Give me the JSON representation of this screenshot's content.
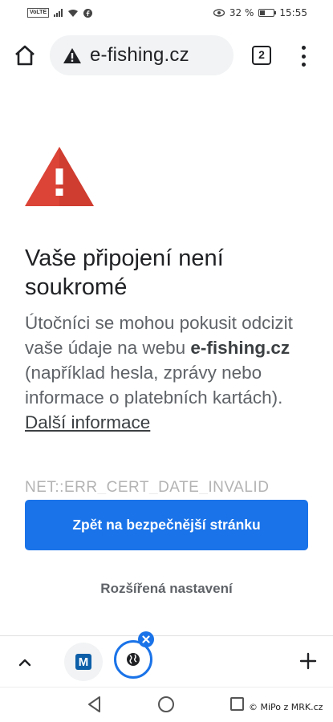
{
  "status_bar": {
    "volte": "VoLTE",
    "battery_percent": "32 %",
    "battery_level": 0.32,
    "time": "15:55"
  },
  "address_bar": {
    "url": "e-fishing.cz",
    "tab_count": "2"
  },
  "page": {
    "heading": "Vaše připojení není soukromé",
    "para_1": "Útočníci se mohou pokusit odcizit vaše údaje na webu ",
    "domain": "e-fishing.cz",
    "para_2": " (například hesla, zprávy nebo informace o platebních kartách). ",
    "more_info_link": "Další informace",
    "error_code": "NET::ERR_CERT_DATE_INVALID",
    "primary_button": "Zpět na bezpečnější stránku",
    "secondary_button": "Rozšířená nastavení"
  },
  "bottom_bar": {
    "tab1_icon_letter": "M"
  },
  "nav_bar": {
    "watermark": "© MiPo z MRK.cz"
  },
  "colors": {
    "accent": "#1a73e8",
    "warning": "#db4437"
  }
}
